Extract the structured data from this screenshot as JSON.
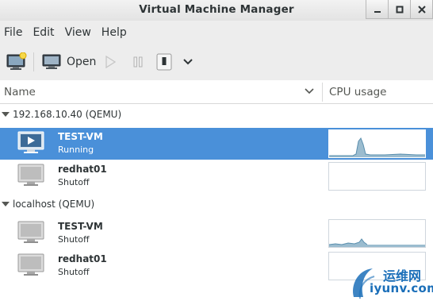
{
  "window": {
    "title": "Virtual Machine Manager"
  },
  "menu": [
    "File",
    "Edit",
    "View",
    "Help"
  ],
  "toolbar": {
    "open_label": "Open"
  },
  "columns": {
    "name": "Name",
    "cpu": "CPU usage"
  },
  "groups": [
    {
      "label": "192.168.10.40 (QEMU)",
      "vms": [
        {
          "name": "TEST-VM",
          "status": "Running",
          "selected": true
        },
        {
          "name": "redhat01",
          "status": "Shutoff",
          "selected": false
        }
      ]
    },
    {
      "label": "localhost (QEMU)",
      "vms": [
        {
          "name": "TEST-VM",
          "status": "Shutoff",
          "selected": false
        },
        {
          "name": "redhat01",
          "status": "Shutoff",
          "selected": false
        }
      ]
    }
  ],
  "watermark": {
    "text_cn": "运维网",
    "text_url": "iyunv.com"
  },
  "colors": {
    "selection": "#4a90d9",
    "graph_fill": "#9bbccf",
    "graph_line": "#5a8fae"
  }
}
